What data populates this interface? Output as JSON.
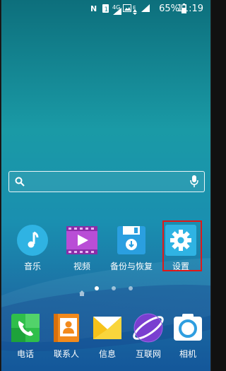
{
  "status_bar": {
    "battery": "65%",
    "time": "11:19",
    "network": "4G"
  },
  "search": {
    "placeholder": ""
  },
  "apps": [
    {
      "label": "音乐",
      "icon": "music-icon"
    },
    {
      "label": "视频",
      "icon": "video-icon"
    },
    {
      "label": "备份与恢复",
      "icon": "backup-icon"
    },
    {
      "label": "设置",
      "icon": "settings-icon"
    }
  ],
  "dock": [
    {
      "label": "电话",
      "icon": "phone-icon"
    },
    {
      "label": "联系人",
      "icon": "contacts-icon"
    },
    {
      "label": "信息",
      "icon": "messages-icon"
    },
    {
      "label": "互联网",
      "icon": "internet-icon"
    },
    {
      "label": "相机",
      "icon": "camera-icon"
    }
  ],
  "page_indicator": {
    "current": 2,
    "total": 4
  },
  "colors": {
    "highlight": "#e01818"
  }
}
